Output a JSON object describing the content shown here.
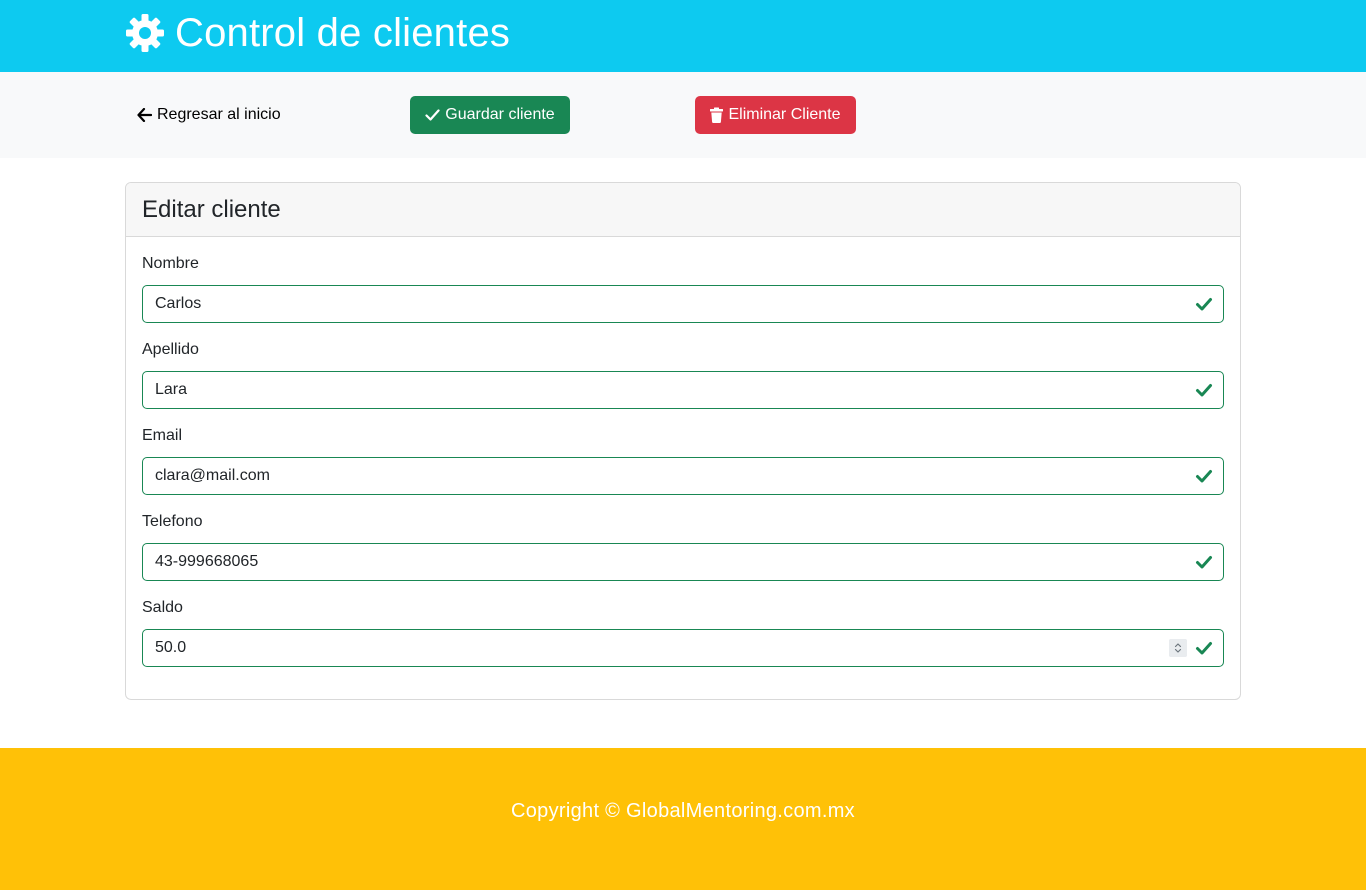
{
  "header": {
    "title": "Control de clientes",
    "icon": "gear-icon"
  },
  "toolbar": {
    "back_label": "Regresar al inicio",
    "save_label": "Guardar cliente",
    "delete_label": "Eliminar Cliente"
  },
  "card": {
    "title": "Editar cliente",
    "fields": [
      {
        "label": "Nombre",
        "value": "Carlos"
      },
      {
        "label": "Apellido",
        "value": "Lara"
      },
      {
        "label": "Email",
        "value": "clara@mail.com"
      },
      {
        "label": "Telefono",
        "value": "43-999668065"
      },
      {
        "label": "Saldo",
        "value": "50.0"
      }
    ]
  },
  "footer": {
    "copyright": "Copyright © GlobalMentoring.com.mx"
  },
  "colors": {
    "header_bg": "#0dcaf0",
    "save_button": "#198754",
    "delete_button": "#dc3545",
    "valid_border": "#198754",
    "footer_bg": "#ffc107"
  }
}
